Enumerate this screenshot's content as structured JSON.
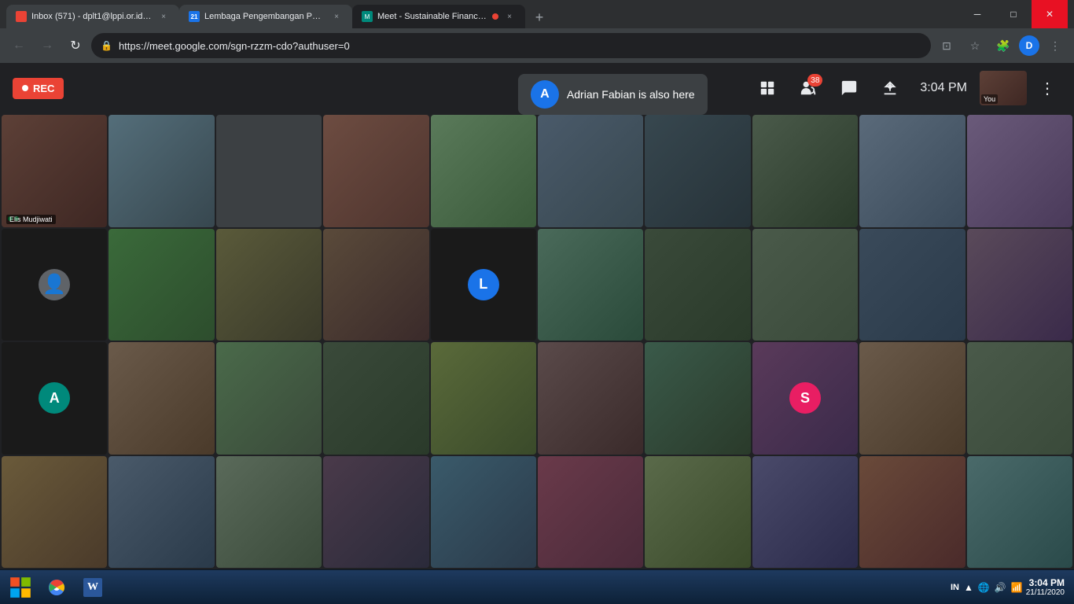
{
  "browser": {
    "tabs": [
      {
        "id": "gmail",
        "label": "Inbox (571) - dplt1@lppi.or.id - L...",
        "icon_type": "gmail",
        "active": false
      },
      {
        "id": "lppi",
        "label": "Lembaga Pengembangan Perba...",
        "icon_type": "lppi",
        "active": false
      },
      {
        "id": "meet",
        "label": "Meet - Sustainable Finance /...",
        "icon_type": "meet",
        "active": true
      }
    ],
    "url": "https://meet.google.com/sgn-rzzm-cdo?authuser=0",
    "window_controls": [
      "_",
      "□",
      "×"
    ]
  },
  "meet": {
    "rec_label": "REC",
    "notification": {
      "avatar_letter": "A",
      "text": "Adrian Fabian is also here"
    },
    "controls": {
      "grid_icon": "⊞",
      "people_icon": "👥",
      "people_count": "38",
      "chat_icon": "💬",
      "present_icon": "📊",
      "time": "3:04 PM",
      "you_label": "You",
      "more_icon": "⋮"
    },
    "participants": [
      {
        "name": "Elis Mudjiwati",
        "has_video": true,
        "bg": "#5d4037"
      },
      {
        "name": "",
        "has_video": true,
        "bg": "#455a64"
      },
      {
        "name": "",
        "has_video": true,
        "bg": "#37474f"
      },
      {
        "name": "",
        "has_video": true,
        "bg": "#4e342e"
      },
      {
        "name": "",
        "has_video": true,
        "bg": "#558b2f"
      },
      {
        "name": "",
        "has_video": true,
        "bg": "#37474f"
      },
      {
        "name": "",
        "has_video": true,
        "bg": "#263238"
      },
      {
        "name": "",
        "has_video": true,
        "bg": "#1b5e20"
      },
      {
        "name": "",
        "has_video": true,
        "bg": "#37474f"
      },
      {
        "name": "",
        "has_video": true,
        "bg": "#4a148c"
      },
      {
        "name": "",
        "has_video": false,
        "bg": "#1a1a1a",
        "avatar": "👤",
        "avatar_color": "#9aa0a6"
      },
      {
        "name": "",
        "has_video": true,
        "bg": "#2d6a2d"
      },
      {
        "name": "",
        "has_video": true,
        "bg": "#3a5a3a"
      },
      {
        "name": "",
        "has_video": true,
        "bg": "#4a3a2a"
      },
      {
        "name": "",
        "has_video": false,
        "bg": "#1a1a1a",
        "avatar": "L",
        "avatar_color": "#1a73e8"
      },
      {
        "name": "",
        "has_video": true,
        "bg": "#3a4a3a"
      },
      {
        "name": "",
        "has_video": true,
        "bg": "#2a3a4a"
      },
      {
        "name": "",
        "has_video": true,
        "bg": "#3a2a4a"
      },
      {
        "name": "",
        "has_video": true,
        "bg": "#4a3a5a"
      },
      {
        "name": "",
        "has_video": false,
        "bg": "#1a1a1a",
        "avatar": "A",
        "avatar_color": "#00897b"
      },
      {
        "name": "",
        "has_video": true,
        "bg": "#5a4a3a"
      },
      {
        "name": "",
        "has_video": true,
        "bg": "#3a5a4a"
      },
      {
        "name": "",
        "has_video": true,
        "bg": "#4a5a3a"
      },
      {
        "name": "",
        "has_video": true,
        "bg": "#3a3a5a"
      },
      {
        "name": "",
        "has_video": true,
        "bg": "#5a3a4a"
      },
      {
        "name": "",
        "has_video": true,
        "bg": "#4a4a3a"
      },
      {
        "name": "",
        "has_video": false,
        "bg": "#111",
        "avatar": "S",
        "avatar_color": "#e91e63"
      },
      {
        "name": "",
        "has_video": false,
        "bg": "#111",
        "avatar": "👤",
        "avatar_color": "#9aa0a6"
      },
      {
        "name": "",
        "has_video": true,
        "bg": "#3a4a5a"
      },
      {
        "name": "",
        "has_video": true,
        "bg": "#4a3a3a"
      },
      {
        "name": "",
        "has_video": true,
        "bg": "#3a4a3a"
      },
      {
        "name": "",
        "has_video": true,
        "bg": "#5a4a4a"
      },
      {
        "name": "",
        "has_video": true,
        "bg": "#4a5a5a"
      },
      {
        "name": "",
        "has_video": true,
        "bg": "#3a3a4a"
      },
      {
        "name": "",
        "has_video": true,
        "bg": "#5a5a3a"
      },
      {
        "name": "",
        "has_video": true,
        "bg": "#4a3a5a"
      },
      {
        "name": "",
        "has_video": true,
        "bg": "#3a5a5a"
      },
      {
        "name": "",
        "has_video": true,
        "bg": "#5a3a3a"
      },
      {
        "name": "",
        "has_video": true,
        "bg": "#4a4a5a"
      },
      {
        "name": "",
        "has_video": true,
        "bg": "#3a4a4a"
      }
    ]
  },
  "taskbar": {
    "start_icon": "⊞",
    "apps": [
      {
        "name": "Chrome",
        "icon": "🌐"
      },
      {
        "name": "Word",
        "icon": "W"
      }
    ],
    "tray": {
      "language": "IN",
      "time": "3:04 PM",
      "date": "21/11/2020"
    }
  }
}
